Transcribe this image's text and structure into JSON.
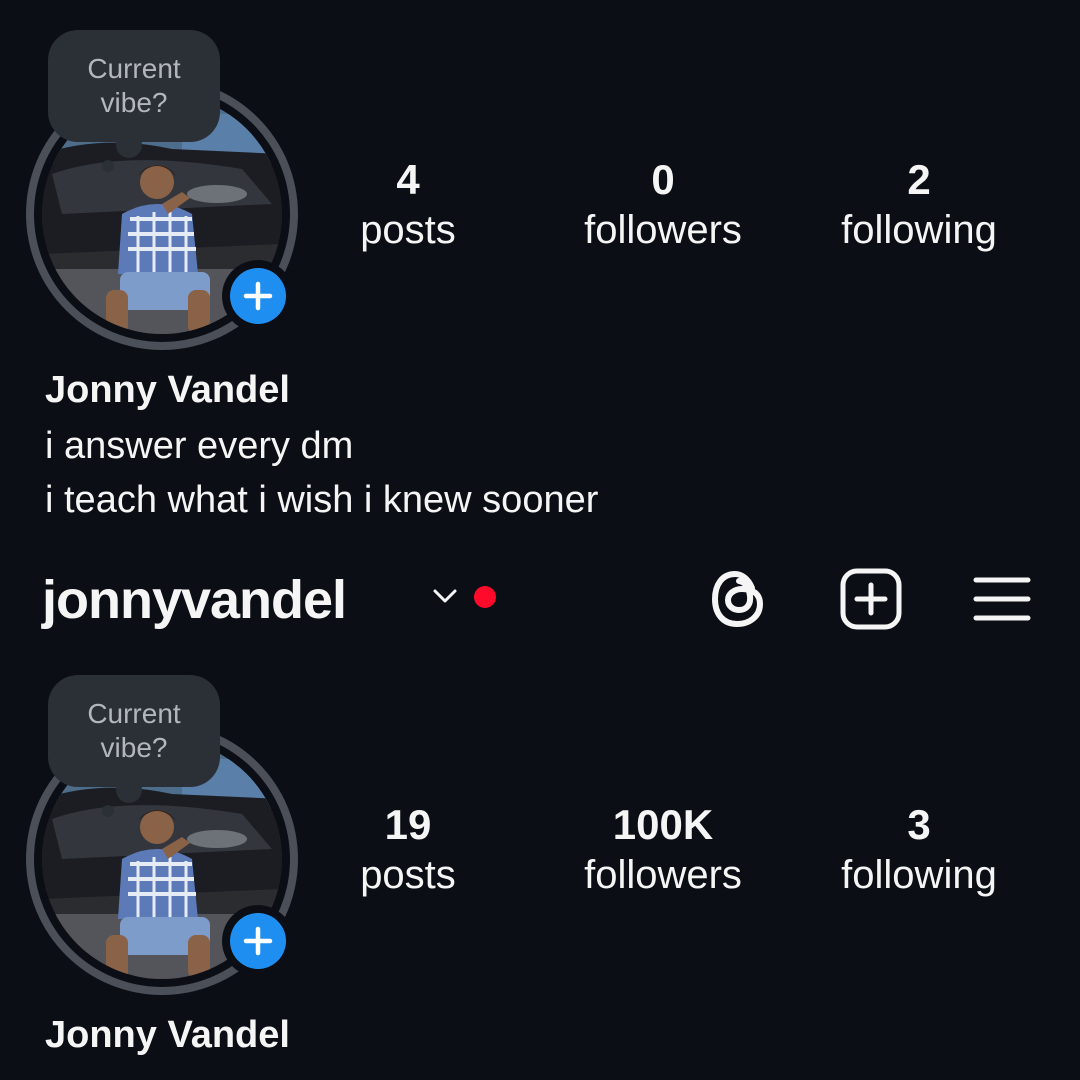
{
  "profiles": [
    {
      "vibe_prompt": "Current\nvibe?",
      "stats": [
        {
          "value": "4",
          "label": "posts"
        },
        {
          "value": "0",
          "label": "followers"
        },
        {
          "value": "2",
          "label": "following"
        }
      ],
      "display_name": "Jonny Vandel",
      "bio": [
        "i answer every dm",
        "i teach what i wish i knew sooner"
      ]
    },
    {
      "vibe_prompt": "Current\nvibe?",
      "stats": [
        {
          "value": "19",
          "label": "posts"
        },
        {
          "value": "100K",
          "label": "followers"
        },
        {
          "value": "3",
          "label": "following"
        }
      ],
      "display_name": "Jonny Vandel"
    }
  ],
  "header": {
    "username": "jonnyvandel",
    "icons": [
      "chevron-down-icon",
      "notification-dot",
      "threads-icon",
      "new-post-icon",
      "menu-icon"
    ]
  },
  "colors": {
    "background": "#0b0e14",
    "accent_blue": "#1e8ff0",
    "notification_red": "#ff0a2a",
    "bubble": "#2b2f36"
  }
}
